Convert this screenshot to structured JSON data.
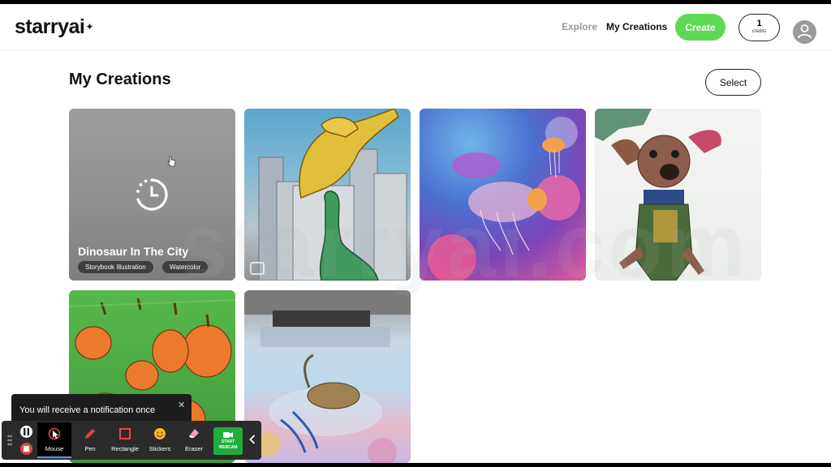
{
  "header": {
    "logo": "starryai",
    "logo_spark": "✦",
    "nav": {
      "explore": "Explore",
      "my_creations": "My Creations"
    },
    "create_label": "Create",
    "credits": {
      "count": "1",
      "label": "credits"
    }
  },
  "page": {
    "title": "My Creations",
    "select_label": "Select",
    "watermark": "starryai.com"
  },
  "creations": [
    {
      "status": "pending",
      "title": "Dinosaur In The City",
      "tags": [
        "Storybook Illustration",
        "Watercolor"
      ]
    },
    {
      "subject": "dinosaur city watercolor"
    },
    {
      "subject": "jellyfish"
    },
    {
      "subject": "dog collage"
    },
    {
      "subject": "pumpkins"
    },
    {
      "subject": "creature in water"
    }
  ],
  "toast": {
    "text": "You will receive a notification once",
    "close": "✕"
  },
  "toolbar": {
    "tools": [
      "Mouse",
      "Pen",
      "Rectangle",
      "Stickers",
      "Eraser"
    ],
    "webcam": [
      "START",
      "WEBCAM"
    ]
  },
  "colors": {
    "accent_green": "#5fd855",
    "webcam_green": "#1fae3d",
    "record_red": "#e84545"
  }
}
